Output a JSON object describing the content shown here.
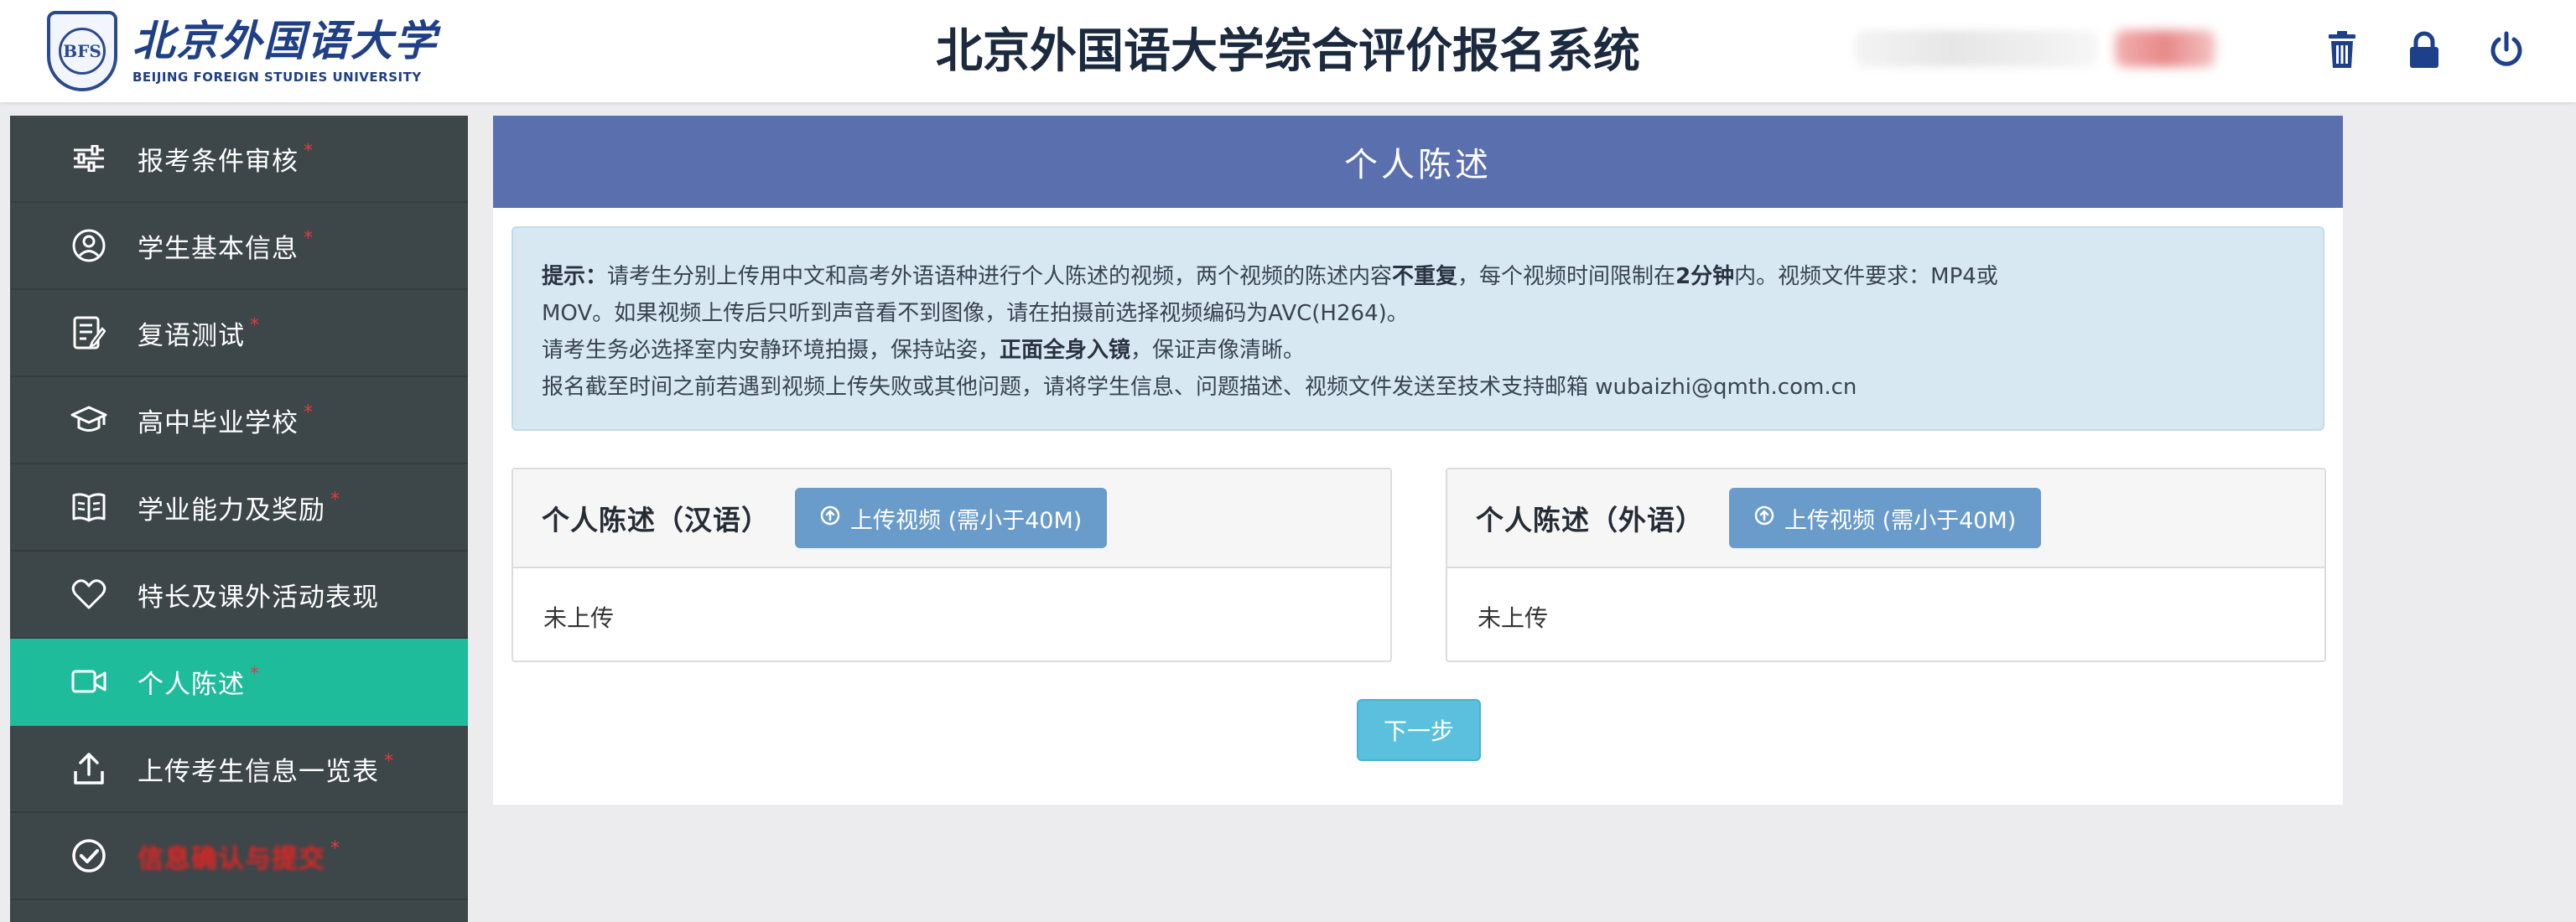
{
  "header": {
    "logo_cn": "北京外国语大学",
    "logo_en": "BEIJING FOREIGN STUDIES UNIVERSITY",
    "title": "北京外国语大学综合评价报名系统",
    "icons": [
      "trash-icon",
      "lock-icon",
      "power-icon"
    ]
  },
  "sidebar": {
    "items": [
      {
        "label": "报考条件审核",
        "icon": "sliders-icon",
        "required": "*"
      },
      {
        "label": "学生基本信息",
        "icon": "user-circle-icon",
        "required": "*"
      },
      {
        "label": "复语测试",
        "icon": "edit-document-icon",
        "required": "*"
      },
      {
        "label": "高中毕业学校",
        "icon": "graduation-cap-icon",
        "required": "*"
      },
      {
        "label": "学业能力及奖励",
        "icon": "book-icon",
        "required": "*"
      },
      {
        "label": "特长及课外活动表现",
        "icon": "heart-icon",
        "required": ""
      },
      {
        "label": "个人陈述",
        "icon": "video-camera-icon",
        "required": "*",
        "active": true
      },
      {
        "label": "上传考生信息一览表",
        "icon": "upload-icon",
        "required": "*"
      },
      {
        "label": "信息确认与提交",
        "icon": "check-circle-icon",
        "required": "*",
        "redacted": true
      }
    ]
  },
  "main": {
    "panel_title": "个人陈述",
    "notice": {
      "l1_label": "提示：",
      "l1_a": "请考生分别上传用中文和高考外语语种进行个人陈述的视频，两个视频的陈述内容",
      "l1_bold1": "不重复",
      "l1_b": "，每个视频时间限制在",
      "l1_bold2": "2分钟",
      "l1_c": "内。视频文件要求：MP4或",
      "l2": "MOV。如果视频上传后只听到声音看不到图像，请在拍摄前选择视频编码为AVC(H264)。",
      "l3_a": "请考生务必选择室内安静环境拍摄，保持站姿，",
      "l3_bold": "正面全身入镜",
      "l3_b": "，保证声像清晰。",
      "l4": "报名截至时间之前若遇到视频上传失败或其他问题，请将学生信息、问题描述、视频文件发送至技术支持邮箱 wubaizhi@qmth.com.cn"
    },
    "cards": [
      {
        "title": "个人陈述（汉语）",
        "upload_label": "上传视频 (需小于40M)",
        "status": "未上传"
      },
      {
        "title": "个人陈述（外语）",
        "upload_label": "上传视频 (需小于40M)",
        "status": "未上传"
      }
    ],
    "next_label": "下一步"
  }
}
